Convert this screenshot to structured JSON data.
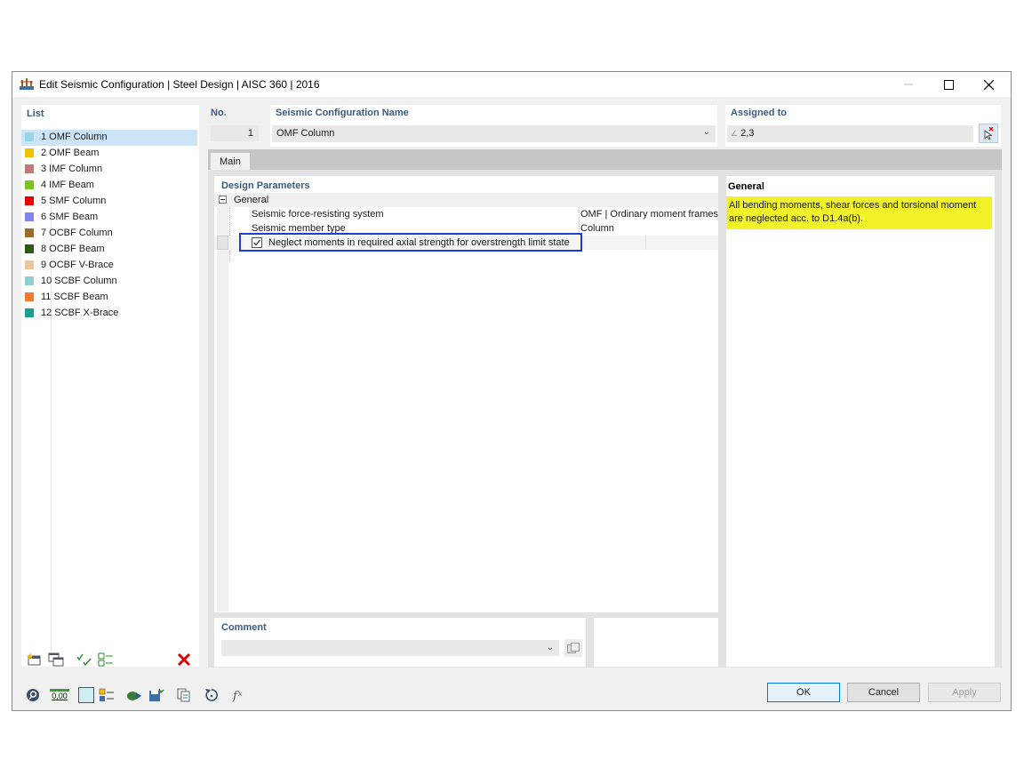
{
  "window": {
    "title": "Edit Seismic Configuration | Steel Design | AISC 360 | 2016"
  },
  "list": {
    "label": "List",
    "items": [
      {
        "label": "1 OMF Column",
        "color": "#99d5ea",
        "selected": true
      },
      {
        "label": "2 OMF Beam",
        "color": "#f2c200"
      },
      {
        "label": "3 IMF Column",
        "color": "#bf7a78"
      },
      {
        "label": "4 IMF Beam",
        "color": "#7bc520"
      },
      {
        "label": "5 SMF Column",
        "color": "#ee0000"
      },
      {
        "label": "6 SMF Beam",
        "color": "#8585f0"
      },
      {
        "label": "7 OCBF Column",
        "color": "#9b6b2a"
      },
      {
        "label": "8 OCBF Beam",
        "color": "#2f5a16"
      },
      {
        "label": "9 OCBF V-Brace",
        "color": "#ecc49a"
      },
      {
        "label": "10 SCBF Column",
        "color": "#8fcfd0"
      },
      {
        "label": "11 SCBF Beam",
        "color": "#f07a30"
      },
      {
        "label": "12 SCBF X-Brace",
        "color": "#1e9e90"
      }
    ]
  },
  "number": {
    "label": "No.",
    "value": "1"
  },
  "name": {
    "label": "Seismic Configuration Name",
    "value": "OMF Column"
  },
  "assigned": {
    "label": "Assigned to",
    "value": "2,3"
  },
  "tabs": {
    "main": "Main"
  },
  "design_parameters": {
    "title": "Design Parameters",
    "group": "General",
    "rows": [
      {
        "label": "Seismic force-resisting system",
        "value": "OMF | Ordinary moment frames"
      },
      {
        "label": "Seismic member type",
        "value": "Column"
      }
    ],
    "checkbox": {
      "label": "Neglect moments in required axial strength for overstrength limit state",
      "checked": true
    }
  },
  "comment": {
    "label": "Comment",
    "value": ""
  },
  "info": {
    "title": "General",
    "text": "All bending moments, shear forces and torsional moment are neglected acc. to D1.4a(b)."
  },
  "bottom_tools": {
    "zero_label": "0,00"
  },
  "buttons": {
    "ok": "OK",
    "cancel": "Cancel",
    "apply": "Apply"
  },
  "colors": {
    "header": "#3a5a82",
    "highlight": "#f2f22a",
    "selection": "#cce4f7",
    "focus_border": "#1a3ccf"
  }
}
